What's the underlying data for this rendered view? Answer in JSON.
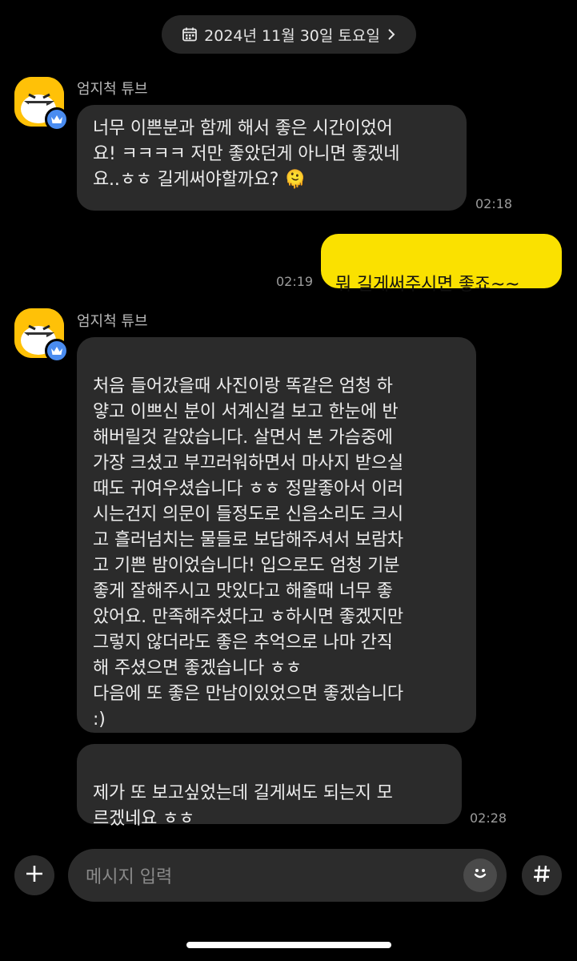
{
  "date_header": {
    "label": "2024년 11월 30일 토요일"
  },
  "messages": [
    {
      "sender": "엄지척 튜브",
      "text": "너무 이쁜분과 함께 해서 좋은 시간이었어\n요! ㅋㅋㅋㅋ 저만 좋았던게 아니면 좋겠네\n요..ㅎㅎ 길게써야할까요?",
      "emoji": "🫠",
      "time": "02:18"
    },
    {
      "sender": "me",
      "text": "뭐 길게써주시면 좋죠~~",
      "time": "02:19"
    },
    {
      "sender": "엄지척 튜브",
      "text": "처음 들어갔을때 사진이랑 똑같은 엄청 하\n얗고 이쁘신 분이 서계신걸 보고 한눈에 반\n해버릴것 같았습니다. 살면서 본 가슴중에\n가장 크셨고 부끄러워하면서 마사지 받으실\n때도 귀여우셨습니다 ㅎㅎ 정말좋아서 이러\n시는건지 의문이 들정도로 신음소리도 크시\n고 흘러넘치는 물들로 보답해주셔서 보람차\n고 기쁜 밤이었습니다! 입으로도 엄청 기분\n좋게 잘해주시고 맛있다고 해줄때 너무 좋\n았어요. 만족해주셨다고 ㅎ하시면 좋겠지만\n그렇지 않더라도 좋은 추억으로 나마 간직\n해 주셨으면 좋겠습니다 ㅎㅎ\n다음에 또 좋은 만남이있었으면 좋겠습니다\n:)"
    },
    {
      "sender": "엄지척 튜브",
      "text": "제가 또 보고싶었는데 길게써도 되는지 모\n르겠네요 ㅎㅎ",
      "time": "02:28"
    }
  ],
  "composer": {
    "placeholder": "메시지 입력",
    "add_icon": "plus-icon",
    "emoji_icon": "smiley-icon",
    "hashtag_icon": "hashtag-icon"
  },
  "colors": {
    "background": "#000000",
    "incoming_bubble": "#2b2b2b",
    "outgoing_bubble": "#fae100",
    "avatar": "#ffc107",
    "badge": "#4a8cf0"
  }
}
